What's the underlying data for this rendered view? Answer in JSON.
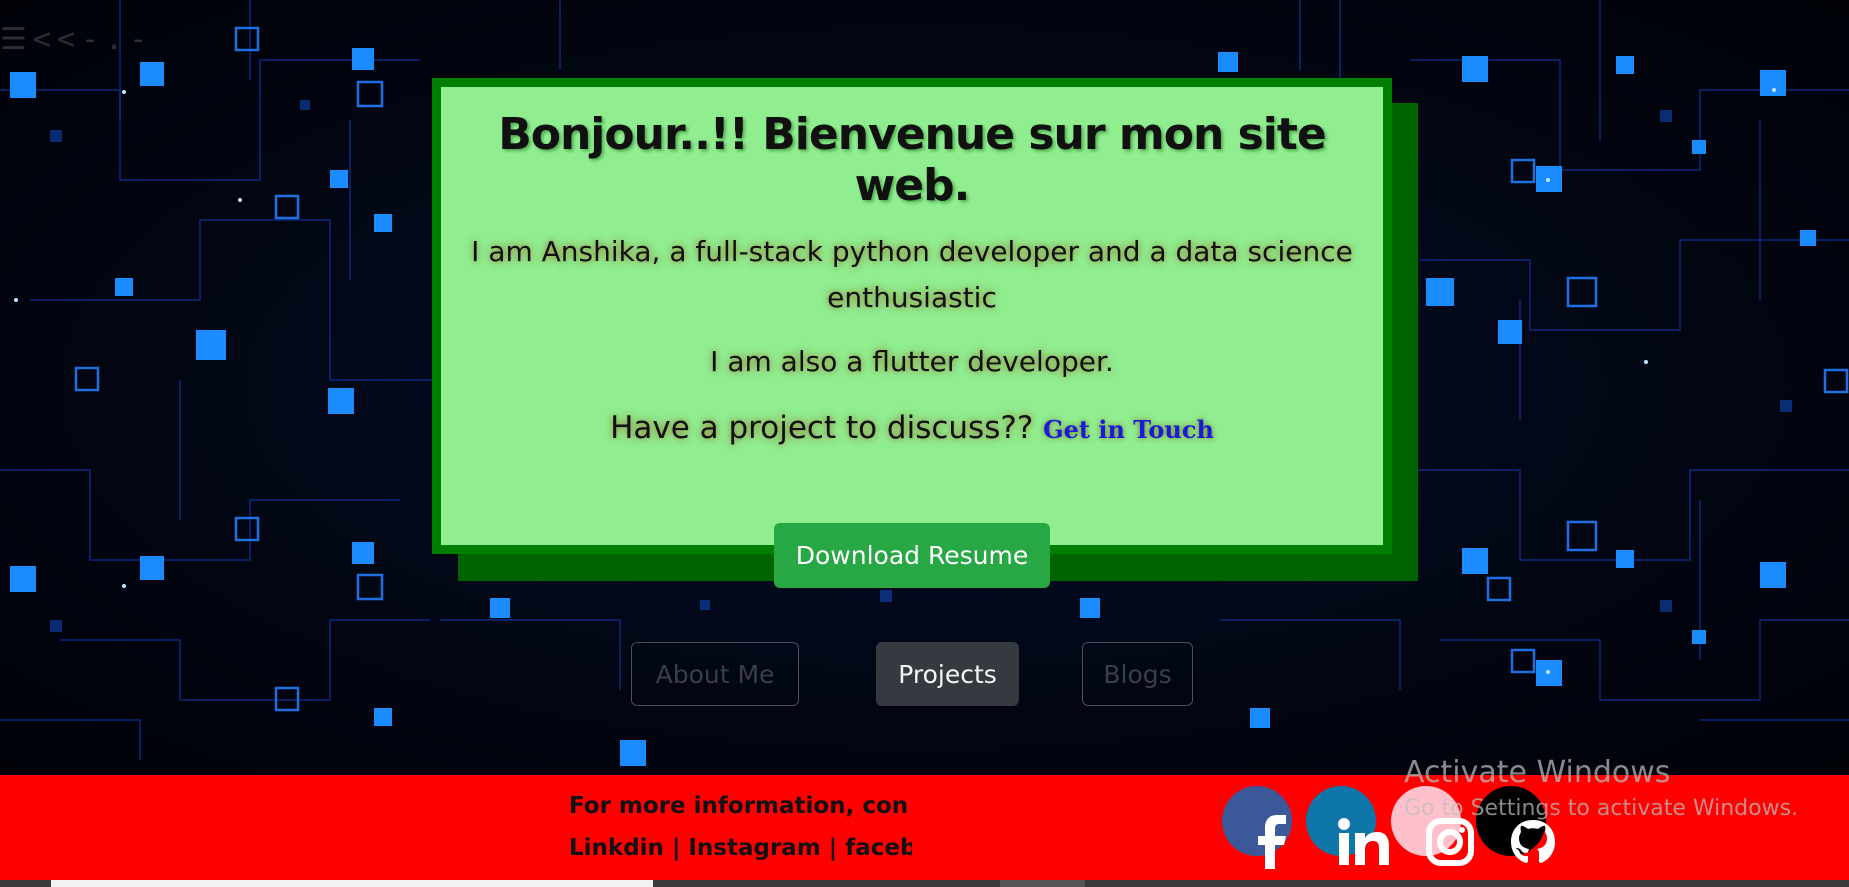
{
  "header": {
    "back_nav": "☰<<-.-"
  },
  "card": {
    "title": "Bonjour..!! Bienvenue sur mon site web.",
    "intro": "I am Anshika, a full-stack python developer and a data science enthusiastic",
    "flutter": "I am also a flutter developer.",
    "project_prompt": "Have a project to discuss??",
    "get_in_touch": "Get in Touch"
  },
  "download_button": "Download Resume",
  "nav": {
    "about": "About Me",
    "projects": "Projects",
    "blogs": "Blogs"
  },
  "footer": {
    "marquee_line1": "For more information, con",
    "marquee_line2": "Linkdin | Instagram | faceb",
    "social": [
      {
        "name": "facebook",
        "icon": "facebook-icon",
        "color": "#3b5998"
      },
      {
        "name": "linkedin",
        "icon": "linkedin-icon",
        "color": "#0e76a8"
      },
      {
        "name": "instagram",
        "icon": "instagram-icon",
        "color": "#ffc0cb"
      },
      {
        "name": "github",
        "icon": "github-icon",
        "color": "#000000"
      }
    ],
    "background_color": "#ff0000"
  },
  "watermark": {
    "line1": "Activate Windows",
    "line2": "Go to Settings to activate Windows."
  },
  "colors": {
    "card_bg": "#90ee90",
    "card_border": "#008000",
    "download_bg": "#28a745",
    "projects_bg": "#343a40",
    "link": "#1a1adc"
  }
}
